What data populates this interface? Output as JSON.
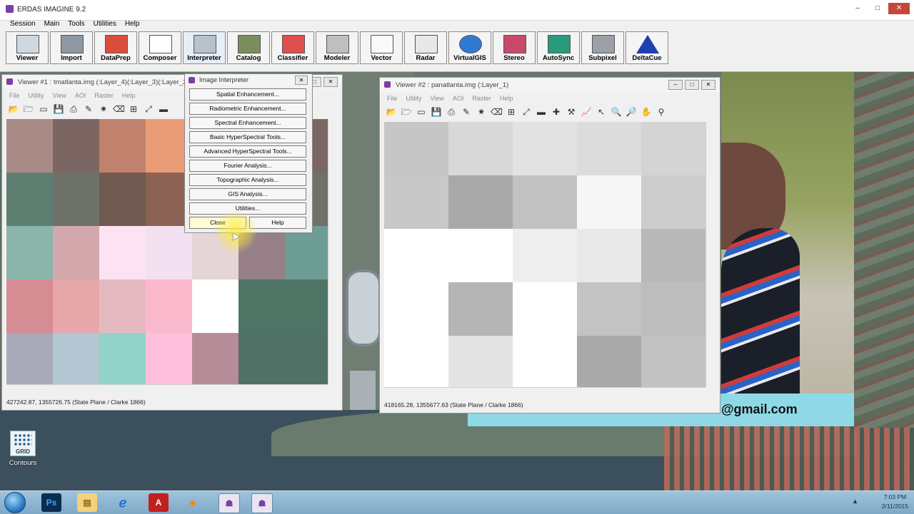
{
  "app": {
    "title": "ERDAS IMAGINE 9.2",
    "window_buttons": {
      "minimize": "–",
      "maximize": "□",
      "close": "✕"
    },
    "menu": [
      "Session",
      "Main",
      "Tools",
      "Utilities",
      "Help"
    ],
    "toolbar": [
      "Viewer",
      "Import",
      "DataPrep",
      "Composer",
      "Interpreter",
      "Catalog",
      "Classifier",
      "Modeler",
      "Vector",
      "Radar",
      "VirtualGIS",
      "Stereo",
      "AutoSync",
      "Subpixel",
      "DeltaCue"
    ]
  },
  "viewer1": {
    "title": "Viewer #1 : tmatlanta.img (:Layer_4)(:Layer_3)(:Layer_2)",
    "menu": [
      "File",
      "Utility",
      "View",
      "AOI",
      "Raster",
      "Help"
    ],
    "status": "427242.87, 1355726.75   (State Plane / Clarke 1866)",
    "pixels": [
      [
        "#a88a86",
        "#7c6663",
        "#c0826c",
        "#ea9c76",
        "#bb8a78"
      ],
      [
        "#5f7e72",
        "#6e7268",
        "#715a52",
        "#8b6254",
        "#9a8c86"
      ],
      [
        "#8bb4ab",
        "#d3a8ad",
        "#fde3f2",
        "#f3e1f2",
        "#e4d6d6",
        "#977f88",
        "#6d9d95"
      ],
      [
        "#d58c92",
        "#e7a7aa",
        "#e4bac0",
        "#fab8cd",
        "#ffffff",
        "#4d7465",
        "#4d7465"
      ],
      [
        "#a8aab7",
        "#b4c6d2",
        "#92d2c8",
        "#ffc0dc",
        "#b68c98",
        "#4f7166",
        "#4f7166"
      ]
    ]
  },
  "viewer2": {
    "title": "Viewer #2 : panatlanta.img (:Layer_1)",
    "menu": [
      "File",
      "Utility",
      "View",
      "AOI",
      "Raster",
      "Help"
    ],
    "status": "418165.28, 1355677.63   (State Plane / Clarke 1866)",
    "pixels": [
      [
        "#c6c6c6",
        "#d8d8d8",
        "#e2e2e2",
        "#dcdcdc",
        "#d4d4d4"
      ],
      [
        "#c8c8c8",
        "#a9a9a9",
        "#c2c2c2",
        "#f6f6f6",
        "#cdcdcd"
      ],
      [
        "#ffffff",
        "#ffffff",
        "#eeeeee",
        "#e9e9e9",
        "#b9b9b9"
      ],
      [
        "#ffffff",
        "#b5b5b5",
        "#ffffff",
        "#c3c3c3",
        "#bdbdbd"
      ],
      [
        "#ffffff",
        "#e4e4e4",
        "#ffffff",
        "#a9a9a9",
        "#c2c2c2"
      ]
    ]
  },
  "dialog": {
    "title": "Image Interpreter",
    "buttons": [
      "Spatial Enhancement...",
      "Radiometric Enhancement...",
      "Spectral Enhancement...",
      "Basic HyperSpectral Tools...",
      "Advanced HyperSpectral Tools...",
      "Fourier Analysis...",
      "Topographic Analysis...",
      "GIS Analysis...",
      "Utilities..."
    ],
    "close": "Close",
    "help": "Help"
  },
  "desktop": {
    "grid_text": "GRID",
    "icon_label": "Contours",
    "email": "@gmail.com"
  },
  "taskbar": {
    "time": "7:03 PM",
    "date": "2/11/2015"
  }
}
